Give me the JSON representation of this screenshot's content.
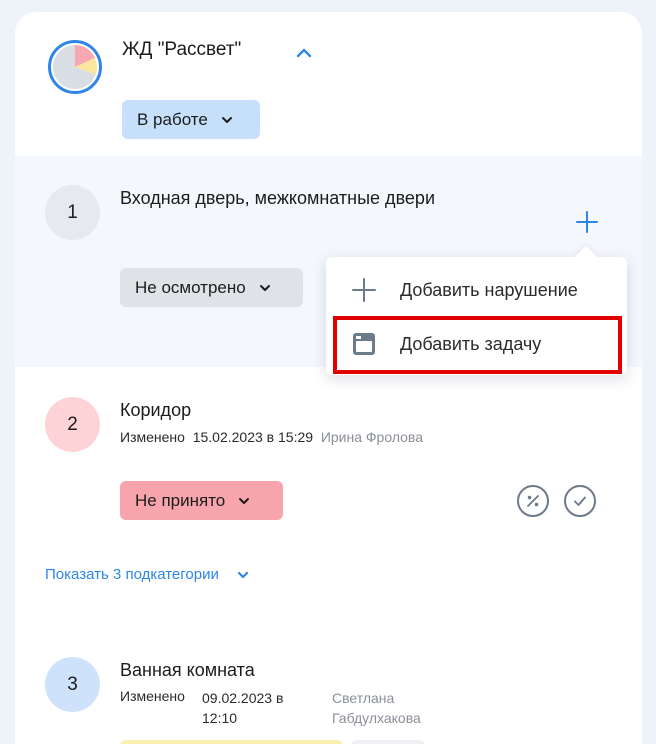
{
  "header": {
    "org_name": "ЖД \"Рассвет\"",
    "status": "В работе"
  },
  "rooms": [
    {
      "number": "1",
      "title": "Входная дверь, межкомнатные двери",
      "status": "Не осмотрено"
    },
    {
      "number": "2",
      "title": "Коридор",
      "changed_label": "Изменено",
      "changed_date": "15.02.2023 в 15:29",
      "author": "Ирина Фролова",
      "status": "Не принято",
      "show_subcategories": "Показать 3 подкатегории"
    },
    {
      "number": "3",
      "title": "Ванная комната",
      "changed_label": "Изменено",
      "changed_date": "09.02.2023 в 12:10",
      "author": "Светлана Габдулхакова"
    }
  ],
  "popup_menu": {
    "items": [
      {
        "label": "Добавить нарушение",
        "icon": "plus-icon"
      },
      {
        "label": "Добавить задачу",
        "icon": "task-icon"
      }
    ]
  },
  "colors": {
    "accent": "#2f86e8",
    "status_in_work": "#c6dffb",
    "status_uninspected": "#dfe2e7",
    "status_rejected": "#f8a4ad",
    "highlight": "#e00000"
  }
}
